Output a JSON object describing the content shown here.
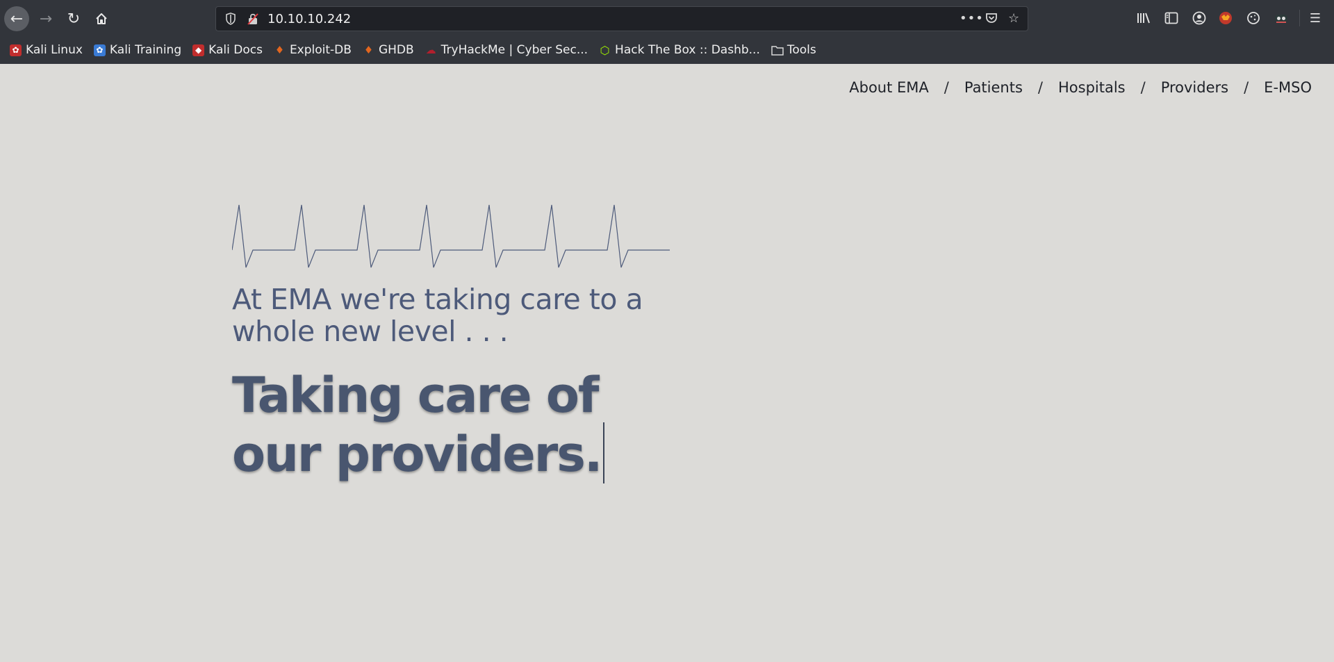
{
  "browser": {
    "url": "10.10.10.242",
    "bookmarks": [
      {
        "label": "Kali Linux",
        "icon": "kali-icon",
        "color": "#c12d2d"
      },
      {
        "label": "Kali Training",
        "icon": "kali-training-icon",
        "color": "#3a7bd5"
      },
      {
        "label": "Kali Docs",
        "icon": "kali-docs-icon",
        "color": "#c12d2d"
      },
      {
        "label": "Exploit-DB",
        "icon": "exploit-db-icon",
        "color": "#e2661f"
      },
      {
        "label": "GHDB",
        "icon": "ghdb-icon",
        "color": "#e2661f"
      },
      {
        "label": "TryHackMe | Cyber Sec...",
        "icon": "tryhackme-icon",
        "color": "#b21f2d"
      },
      {
        "label": "Hack The Box :: Dashb...",
        "icon": "hackthebox-icon",
        "color": "#9fef00"
      },
      {
        "label": "Tools",
        "icon": "folder-icon",
        "color": "#d8d8d8"
      }
    ]
  },
  "site": {
    "nav": [
      "About EMA",
      "Patients",
      "Hospitals",
      "Providers",
      "E-MSO"
    ],
    "separator": "/",
    "tagline": "At EMA we're taking care to a whole new level . . .",
    "headline_line1": "Taking care of",
    "headline_line2": "our providers.",
    "accent_color": "#4d5a7a"
  }
}
